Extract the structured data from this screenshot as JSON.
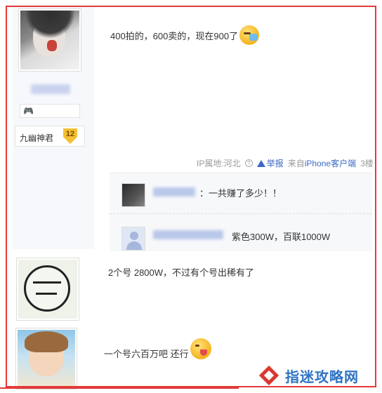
{
  "post1": {
    "level_name": "九幽神君",
    "level_num": "12",
    "content": "400拍的，600卖的，现在900了",
    "emoji": "sneeze-emoji",
    "tail": {
      "ip_label": "IP属地:河北",
      "report": "举报",
      "from_prefix": "来自",
      "client": "iPhone客户端",
      "floor": "3楼"
    },
    "replies": [
      {
        "text": "：一共赚了多少！！"
      },
      {
        "text": "紫色300W，百联1000W"
      }
    ]
  },
  "post2": {
    "content": "2个号 2800W，不过有个号出稀有了"
  },
  "post3": {
    "content": "一个号六百万吧 还行",
    "emoji": "tongue-emoji"
  },
  "watermark": {
    "text": "指迷攻略网"
  },
  "colors": {
    "highlight": "#e23a3a",
    "link": "#3a69c4",
    "watermark": "#2f73c2"
  }
}
